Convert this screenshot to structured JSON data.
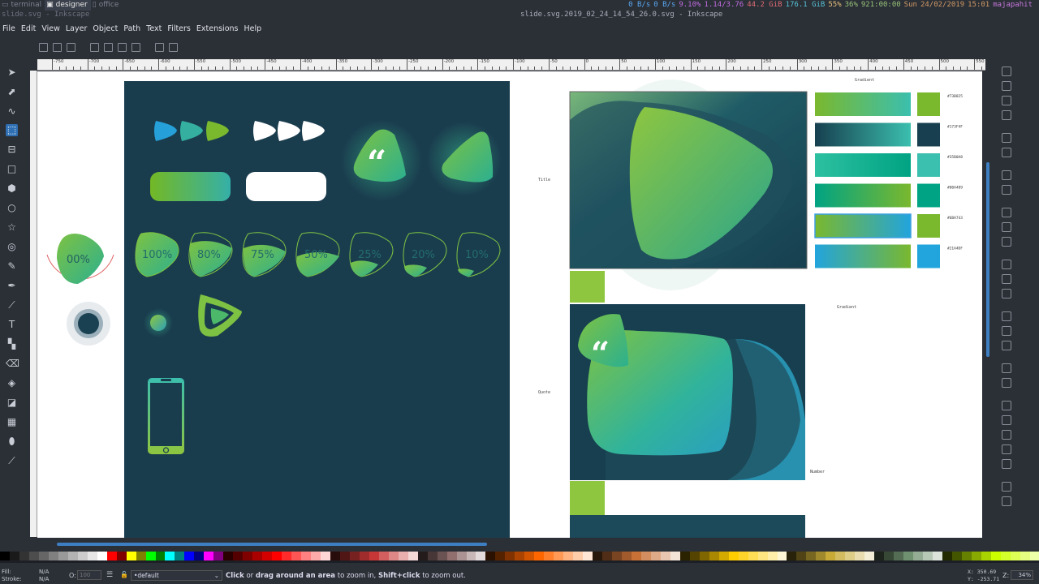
{
  "wm": {
    "tabs": [
      {
        "label": "terminal",
        "active": false
      },
      {
        "label": "designer",
        "active": true
      },
      {
        "label": "office",
        "active": false
      }
    ],
    "status": [
      {
        "text": "0 B/s",
        "color": "#5aa9f2"
      },
      {
        "text": "0 B/s",
        "color": "#5aa9f2"
      },
      {
        "text": "9.10%",
        "color": "#bf6de0"
      },
      {
        "text": "1.14/3.76",
        "color": "#bf6de0"
      },
      {
        "text": "44.2 GiB",
        "color": "#e06c75"
      },
      {
        "text": "176.1 GiB",
        "color": "#56c2d6"
      },
      {
        "text": "55%",
        "color": "#e5c07b"
      },
      {
        "text": "36%",
        "color": "#98c379"
      },
      {
        "text": "921:00:00",
        "color": "#98c379"
      },
      {
        "text": "Sun",
        "color": "#d19a66"
      },
      {
        "text": "24/02/2019",
        "color": "#d19a66"
      },
      {
        "text": "15:01",
        "color": "#d19a66"
      },
      {
        "text": "majapahit",
        "color": "#c678dd"
      }
    ]
  },
  "window": {
    "left_title": "slide.svg - Inkscape",
    "right_title": "slide.svg.2019_02_24_14_54_26.0.svg - Inkscape"
  },
  "menu": [
    "File",
    "Edit",
    "View",
    "Layer",
    "Object",
    "Path",
    "Text",
    "Filters",
    "Extensions",
    "Help"
  ],
  "ruler": {
    "labels": [
      "-750",
      "-700",
      "-650",
      "-600",
      "-550",
      "-500",
      "-450",
      "-400",
      "-350",
      "-300",
      "-250",
      "-200",
      "-150",
      "-100",
      "-50",
      "0",
      "50",
      "100",
      "150",
      "200",
      "250",
      "300",
      "350",
      "400",
      "450",
      "500",
      "550"
    ]
  },
  "slide": {
    "percent_labels": [
      "100%",
      "80%",
      "75%",
      "50%",
      "25%",
      "20%",
      "10%"
    ],
    "progress_label": "00%",
    "quote_mark": "“"
  },
  "labels": {
    "title": "Title",
    "quote": "Quote",
    "gradient_top": "Gradient",
    "gradient_mid": "Gradient",
    "number": "Number"
  },
  "gradients": [
    {
      "from": "#7ab82e",
      "to": "#3bbfae",
      "swatch": "#7ab82e",
      "hex": "#73B825"
    },
    {
      "from": "#173f4f",
      "to": "#3bbfae",
      "swatch": "#173F4F",
      "hex": "#173F4F"
    },
    {
      "from": "#2cc0a0",
      "to": "#00a383",
      "swatch": "#3bbfae",
      "hex": "#35B0A8"
    },
    {
      "from": "#00a383",
      "to": "#7ab82e",
      "swatch": "#00a383",
      "hex": "#00A489"
    },
    {
      "from": "#7ab82e",
      "to": "#22a4dd",
      "swatch": "#7ab82e",
      "hex": "#6BA743"
    },
    {
      "from": "#22a4dd",
      "to": "#7ab82e",
      "swatch": "#22a4dd",
      "hex": "#21A4DF"
    }
  ],
  "palette": [
    "#000000",
    "#1a1a1a",
    "#333333",
    "#4d4d4d",
    "#666666",
    "#808080",
    "#999999",
    "#b3b3b3",
    "#cccccc",
    "#e6e6e6",
    "#ffffff",
    "#ff0000",
    "#800000",
    "#ffff00",
    "#808000",
    "#00ff00",
    "#008000",
    "#00ffff",
    "#008080",
    "#0000ff",
    "#000080",
    "#ff00ff",
    "#800080",
    "#2b0000",
    "#550000",
    "#800000",
    "#aa0000",
    "#d40000",
    "#ff0000",
    "#ff2a2a",
    "#ff5555",
    "#ff8080",
    "#ffaaaa",
    "#ffd5d5",
    "#280b0b",
    "#501616",
    "#782121",
    "#a02c2c",
    "#c83737",
    "#d35f5f",
    "#de8787",
    "#e9afaf",
    "#f4d7d7",
    "#241c1c",
    "#483737",
    "#6c5353",
    "#916f6f",
    "#ac9393",
    "#c8b7b7",
    "#e3dbdb",
    "#2b1100",
    "#552200",
    "#803300",
    "#aa4400",
    "#d45500",
    "#ff6600",
    "#ff7f2a",
    "#ff9955",
    "#ffb380",
    "#ffccaa",
    "#ffe6d5",
    "#28170b",
    "#502d16",
    "#784421",
    "#a05a2c",
    "#c87137",
    "#d38d5f",
    "#deaa87",
    "#e9c6af",
    "#f4e3d7",
    "#2b2200",
    "#554400",
    "#806600",
    "#aa8800",
    "#d4aa00",
    "#ffcc00",
    "#ffd42a",
    "#ffdd55",
    "#ffe680",
    "#ffeeaa",
    "#fff6d5",
    "#28220b",
    "#504416",
    "#786721",
    "#a0892c",
    "#c8ab37",
    "#d3bc5f",
    "#decd87",
    "#e9ddaf",
    "#f4eed7",
    "#1c241c",
    "#374837",
    "#536c53",
    "#6f916f",
    "#93ac93",
    "#b7c8b7",
    "#dbe3db",
    "#222b00",
    "#445500",
    "#668000",
    "#88aa00",
    "#aad400",
    "#ccff00",
    "#d4ff2a",
    "#ddff55",
    "#e5ff80",
    "#eeffaa"
  ],
  "statusbar": {
    "fill_label": "Fill:",
    "fill_value": "N/A",
    "stroke_label": "Stroke:",
    "stroke_value": "N/A",
    "opacity_label": "O:",
    "opacity_value": "100",
    "layer": "•default",
    "hint_bold1": "Click",
    "hint_1": " or ",
    "hint_bold2": "drag around an area",
    "hint_2": " to zoom in, ",
    "hint_bold3": "Shift+click",
    "hint_3": " to zoom out.",
    "x": "X: 350.69",
    "y": "Y: -253.71",
    "z_label": "Z:",
    "zoom": "34%"
  }
}
